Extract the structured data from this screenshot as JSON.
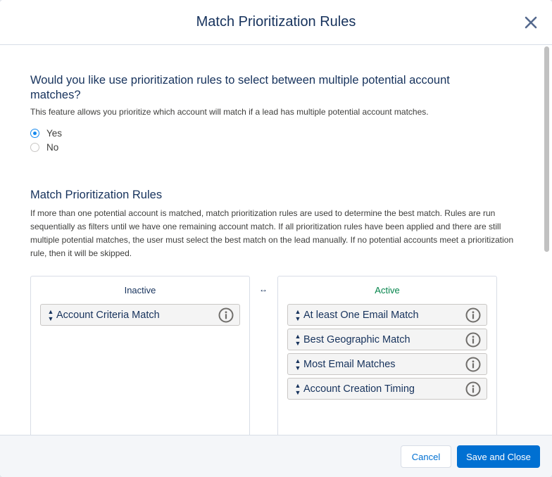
{
  "modal": {
    "title": "Match Prioritization Rules",
    "close_icon": "close-icon"
  },
  "question": {
    "title": "Would you like use prioritization rules to select between multiple potential account matches?",
    "description": "This feature allows you prioritize which account will match if a lead has multiple potential account matches.",
    "options": [
      {
        "label": "Yes",
        "checked": true
      },
      {
        "label": "No",
        "checked": false
      }
    ]
  },
  "rules_section": {
    "title": "Match Prioritization Rules",
    "description": "If more than one potential account is matched, match prioritization rules are used to determine the best match. Rules are run sequentially as filters until we have one remaining account match. If all prioritization rules have been applied and there are still multiple potential matches, the user must select the best match on the lead manually. If no potential accounts meet a prioritization rule, then it will be skipped.",
    "swap_symbol": "↔",
    "inactive": {
      "title": "Inactive",
      "items": [
        {
          "label": "Account Criteria Match"
        }
      ]
    },
    "active": {
      "title": "Active",
      "items": [
        {
          "label": "At least One Email Match"
        },
        {
          "label": "Best Geographic Match"
        },
        {
          "label": "Most Email Matches"
        },
        {
          "label": "Account Creation Timing"
        }
      ]
    }
  },
  "footer": {
    "cancel_label": "Cancel",
    "save_label": "Save and Close"
  },
  "colors": {
    "brand": "#0070d2",
    "text": "#16325c",
    "active_green": "#04844b",
    "radio_blue": "#1589ee"
  },
  "icons": {
    "drag": "drag-handle-icon",
    "info": "info-icon"
  }
}
